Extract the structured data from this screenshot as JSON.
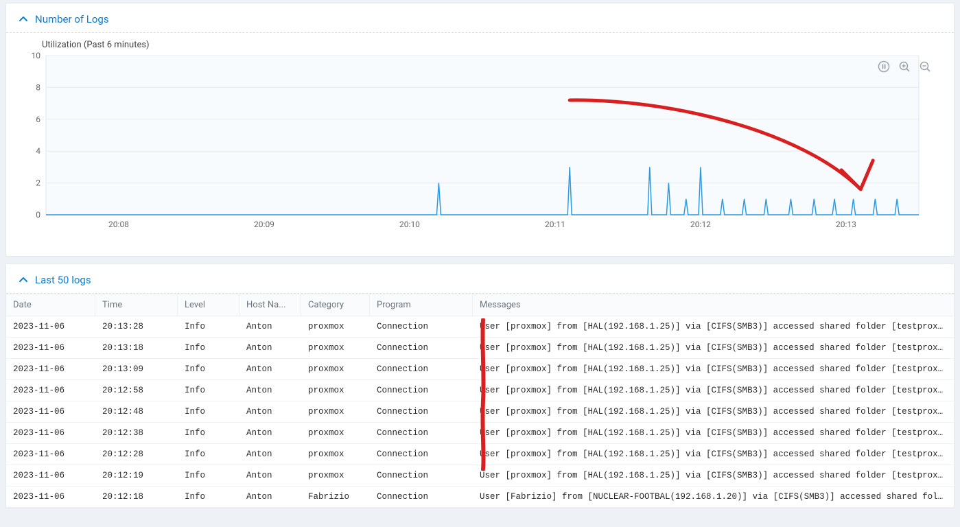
{
  "number_of_logs": {
    "title": "Number of Logs",
    "subtitle": "Utilization (Past 6 minutes)"
  },
  "last_logs": {
    "title": "Last 50 logs"
  },
  "table": {
    "headers": {
      "date": "Date",
      "time": "Time",
      "level": "Level",
      "host": "Host Na...",
      "category": "Category",
      "program": "Program",
      "messages": "Messages"
    },
    "rows": [
      {
        "date": "2023-11-06",
        "time": "20:13:28",
        "level": "Info",
        "host": "Anton",
        "category": "proxmox",
        "program": "Connection",
        "message": "User [proxmox] from [HAL(192.168.1.25)] via [CIFS(SMB3)] accessed shared folder [testproxmox]."
      },
      {
        "date": "2023-11-06",
        "time": "20:13:18",
        "level": "Info",
        "host": "Anton",
        "category": "proxmox",
        "program": "Connection",
        "message": "User [proxmox] from [HAL(192.168.1.25)] via [CIFS(SMB3)] accessed shared folder [testproxmox]."
      },
      {
        "date": "2023-11-06",
        "time": "20:13:09",
        "level": "Info",
        "host": "Anton",
        "category": "proxmox",
        "program": "Connection",
        "message": "User [proxmox] from [HAL(192.168.1.25)] via [CIFS(SMB3)] accessed shared folder [testproxmox]."
      },
      {
        "date": "2023-11-06",
        "time": "20:12:58",
        "level": "Info",
        "host": "Anton",
        "category": "proxmox",
        "program": "Connection",
        "message": "User [proxmox] from [HAL(192.168.1.25)] via [CIFS(SMB3)] accessed shared folder [testproxmox]."
      },
      {
        "date": "2023-11-06",
        "time": "20:12:48",
        "level": "Info",
        "host": "Anton",
        "category": "proxmox",
        "program": "Connection",
        "message": "User [proxmox] from [HAL(192.168.1.25)] via [CIFS(SMB3)] accessed shared folder [testproxmox]."
      },
      {
        "date": "2023-11-06",
        "time": "20:12:38",
        "level": "Info",
        "host": "Anton",
        "category": "proxmox",
        "program": "Connection",
        "message": "User [proxmox] from [HAL(192.168.1.25)] via [CIFS(SMB3)] accessed shared folder [testproxmox]."
      },
      {
        "date": "2023-11-06",
        "time": "20:12:28",
        "level": "Info",
        "host": "Anton",
        "category": "proxmox",
        "program": "Connection",
        "message": "User [proxmox] from [HAL(192.168.1.25)] via [CIFS(SMB3)] accessed shared folder [testproxmox]."
      },
      {
        "date": "2023-11-06",
        "time": "20:12:19",
        "level": "Info",
        "host": "Anton",
        "category": "proxmox",
        "program": "Connection",
        "message": "User [proxmox] from [HAL(192.168.1.25)] via [CIFS(SMB3)] accessed shared folder [testproxmox]."
      },
      {
        "date": "2023-11-06",
        "time": "20:12:18",
        "level": "Info",
        "host": "Anton",
        "category": "Fabrizio",
        "program": "Connection",
        "message": "User [Fabrizio] from [NUCLEAR-FOOTBAL(192.168.1.20)] via [CIFS(SMB3)] accessed shared folder [temp-"
      }
    ]
  },
  "chart_data": {
    "type": "line",
    "title": "Number of Logs",
    "subtitle": "Utilization (Past 6 minutes)",
    "xlabel": "",
    "ylabel": "",
    "ylim": [
      0,
      10
    ],
    "y_ticks": [
      0,
      2,
      4,
      6,
      8,
      10
    ],
    "x_ticks": [
      "20:08",
      "20:09",
      "20:10",
      "20:11",
      "20:12",
      "20:13"
    ],
    "x_range_minutes": [
      7.5,
      13.5
    ],
    "series": [
      {
        "name": "Logs",
        "points": [
          {
            "t": 10.2,
            "v": 2
          },
          {
            "t": 11.1,
            "v": 3
          },
          {
            "t": 11.65,
            "v": 3
          },
          {
            "t": 11.78,
            "v": 2
          },
          {
            "t": 11.9,
            "v": 1
          },
          {
            "t": 12.0,
            "v": 3
          },
          {
            "t": 12.15,
            "v": 1
          },
          {
            "t": 12.3,
            "v": 1
          },
          {
            "t": 12.45,
            "v": 1
          },
          {
            "t": 12.62,
            "v": 1
          },
          {
            "t": 12.78,
            "v": 1
          },
          {
            "t": 12.92,
            "v": 1
          },
          {
            "t": 13.05,
            "v": 1
          },
          {
            "t": 13.2,
            "v": 1
          },
          {
            "t": 13.35,
            "v": 1
          }
        ]
      }
    ],
    "annotation_arrow": {
      "description": "hand-drawn red arrow pointing to ~20:13 spikes",
      "from_t": 11.1,
      "from_v": 7.2,
      "to_t": 13.1,
      "to_v": 1.6
    }
  }
}
